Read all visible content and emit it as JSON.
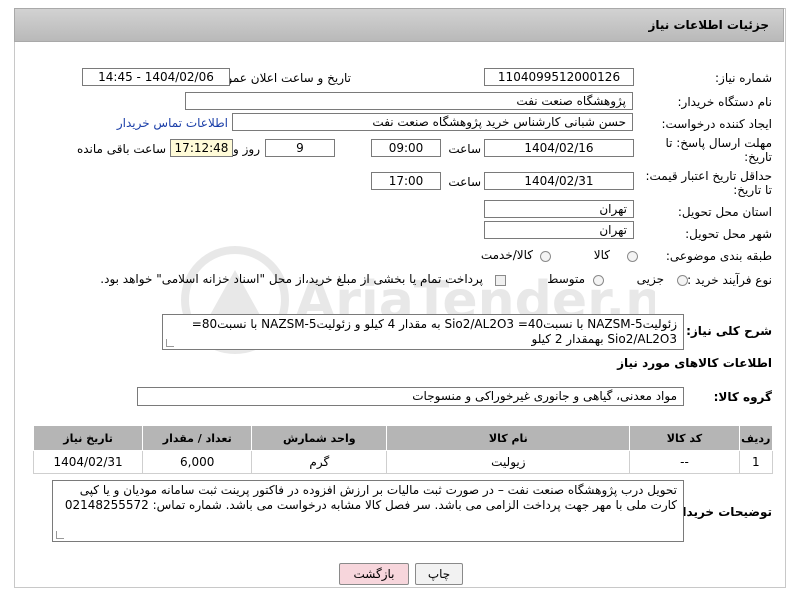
{
  "header": {
    "title": "جزئیات اطلاعات نیاز"
  },
  "fields": {
    "need_number_label": "شماره نیاز:",
    "need_number": "1104099512000126",
    "announce_label": "تاریخ و ساعت اعلان عمومی:",
    "announce_value": "1404/02/06 - 14:45",
    "buyer_org_label": "نام دستگاه خریدار:",
    "buyer_org": "پژوهشگاه صنعت نفت",
    "creator_label": "ایجاد کننده درخواست:",
    "creator": "حسن شبانی کارشناس خرید پژوهشگاه صنعت نفت",
    "contact_link": "اطلاعات تماس خریدار",
    "deadline_label_1": "مهلت ارسال پاسخ: تا",
    "deadline_label_2": "تاریخ:",
    "deadline_date": "1404/02/16",
    "time_label": "ساعت",
    "deadline_time": "09:00",
    "days_value": "9",
    "days_label": "روز و",
    "remaining_time": "17:12:48",
    "remaining_label": "ساعت باقی مانده",
    "validity_label_1": "حداقل تاریخ اعتبار قیمت:",
    "validity_label_2": "تا تاریخ:",
    "validity_date": "1404/02/31",
    "validity_time": "17:00",
    "province_label": "استان محل تحویل:",
    "province": "تهران",
    "city_label": "شهر محل تحویل:",
    "city": "تهران",
    "category_label": "طبقه بندی موضوعی:",
    "category_options": [
      "کالا",
      "کالا/خدمت"
    ],
    "process_label": "نوع فرآیند خرید :",
    "process_options": [
      "جزیی",
      "متوسط"
    ],
    "payment_note": "پرداخت تمام یا بخشی از مبلغ خرید،از محل \"اسناد خزانه اسلامی\" خواهد بود."
  },
  "description": {
    "label": "شرح کلی نیاز:",
    "text": "زئولیتNAZSM-5 با نسبتSio2/AL2O3 =40  به مقدار 4 کیلو و زئولیتNAZSM-5 با نسبت80= Sio2/AL2O3 بهمقدار 2 کیلو"
  },
  "goods_info": {
    "section_title": "اطلاعات کالاهای مورد نیاز",
    "group_label": "گروه کالا:",
    "group_value": "مواد معدنی، گیاهی و جانوری غیرخوراکی و منسوجات"
  },
  "table": {
    "headers": [
      "ردیف",
      "کد کالا",
      "نام کالا",
      "واحد شمارش",
      "تعداد / مقدار",
      "تاریخ نیاز"
    ],
    "rows": [
      [
        "1",
        "--",
        "زیولیت",
        "گرم",
        "6,000",
        "1404/02/31"
      ]
    ]
  },
  "buyer_notes": {
    "label": "توضیحات خریدار:",
    "text": "تحویل درب پژوهشگاه صنعت نفت – در صورت ثبت مالیات بر ارزش افزوده در فاکتور پرینت ثبت سامانه مودیان و یا کپی کارت ملی با مهر جهت پرداخت الزامی می باشد. سر فصل کالا مشابه درخواست می باشد. شماره تماس: 02148255572"
  },
  "buttons": {
    "print": "چاپ",
    "back": "بازگشت"
  },
  "watermark": "AriaTender.neT",
  "colors": {
    "header_bg": "#c2c2c2",
    "yellow_field": "#fffbd8",
    "link": "#1a3ea8",
    "back_button": "#f7d6dc"
  }
}
